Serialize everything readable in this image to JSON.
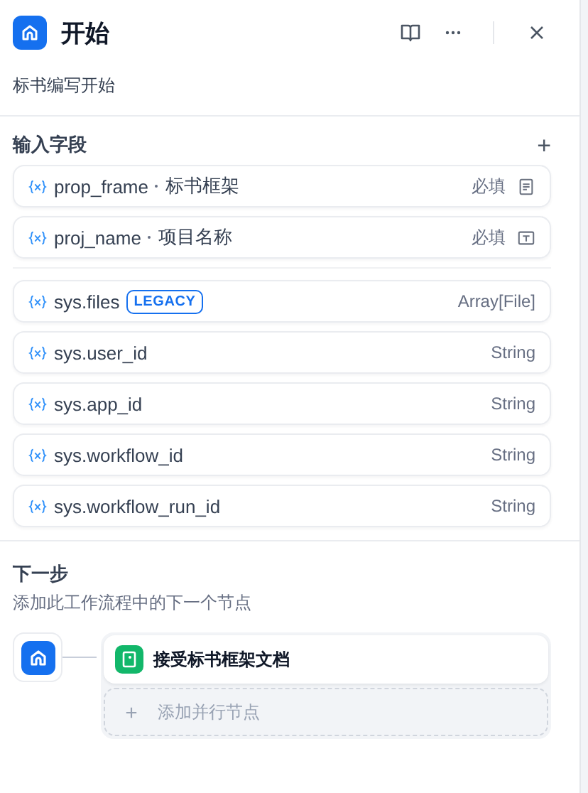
{
  "header": {
    "title": "开始",
    "description": "标书编写开始"
  },
  "input_fields": {
    "title": "输入字段",
    "add": "+",
    "fields": [
      {
        "name": "prop_frame",
        "label": "标书框架",
        "required": "必填",
        "kind": "paragraph"
      },
      {
        "name": "proj_name",
        "label": "项目名称",
        "required": "必填",
        "kind": "text"
      }
    ]
  },
  "system_variables": [
    {
      "name": "sys.files",
      "badge": "LEGACY",
      "type": "Array[File]"
    },
    {
      "name": "sys.user_id",
      "type": "String"
    },
    {
      "name": "sys.app_id",
      "type": "String"
    },
    {
      "name": "sys.workflow_id",
      "type": "String"
    },
    {
      "name": "sys.workflow_run_id",
      "type": "String"
    }
  ],
  "next_step": {
    "title": "下一步",
    "description": "添加此工作流程中的下一个节点",
    "nodes": [
      {
        "label": "接受标书框架文档"
      }
    ],
    "add_parallel": "添加并行节点"
  }
}
